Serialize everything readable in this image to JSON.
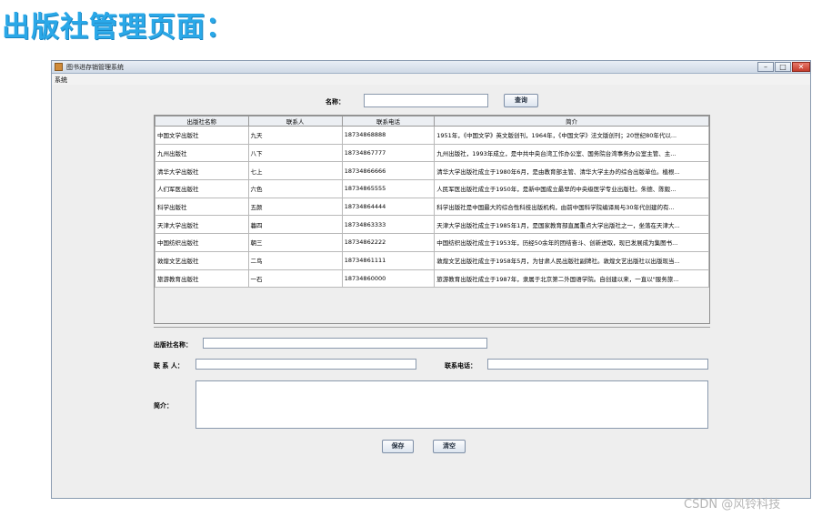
{
  "heading": "出版社管理页面：",
  "window": {
    "title": "图书进存销管理系统",
    "minimize": "–",
    "maximize": "□",
    "close": "✕",
    "menu": [
      "系统"
    ]
  },
  "search": {
    "label": "名称：",
    "value": "",
    "button": "查询"
  },
  "table": {
    "columns": [
      "出版社名称",
      "联系人",
      "联系电话",
      "简介"
    ],
    "rows": [
      [
        "中国文学出版社",
        "九天",
        "18734868888",
        "1951年，《中国文学》英文版创刊，1964年，《中国文学》法文版创刊；20世纪80年代以..."
      ],
      [
        "九州出版社",
        "八下",
        "18734867777",
        "九州出版社，1993年成立，是中共中央台湾工作办公室、国务院台湾事务办公室主管、主..."
      ],
      [
        "清华大学出版社",
        "七上",
        "18734866666",
        "清华大学出版社成立于1980年6月，是由教育部主管、清华大学主办的综合出版单位。植根..."
      ],
      [
        "人们军医出版社",
        "六色",
        "18734865555",
        "人民军医出版社成立于1950年，是新中国成立最早的中央级医学专业出版社。朱德、陈毅..."
      ],
      [
        "科学出版社",
        "五颜",
        "18734864444",
        "科学出版社是中国最大的综合性科技出版机构，由前中国科学院编译局与30年代创建的有..."
      ],
      [
        "天津大学出版社",
        "暮四",
        "18734863333",
        "天津大学出版社成立于1985年1月，是国家教育部直属重点大学出版社之一，坐落在天津大..."
      ],
      [
        "中国纺织出版社",
        "朝三",
        "18734862222",
        "中国纺织出版社成立于1953年，历经50余年的团结奋斗、创新进取，现已发展成为集图书..."
      ],
      [
        "敦煌文艺出版社",
        "二鸟",
        "18734861111",
        "敦煌文艺出版社成立于1958年5月，为甘肃人民出版社副牌社。敦煌文艺出版社以出版现当..."
      ],
      [
        "旅游教育出版社",
        "一石",
        "18734860000",
        "旅游教育出版社成立于1987年，隶属于北京第二外国语学院。自创建以来，一直以\"服务旅..."
      ]
    ]
  },
  "form": {
    "name_label": "出版社名称：",
    "name_value": "",
    "contact_label": "联 系 人：",
    "contact_value": "",
    "phone_label": "联系电话：",
    "phone_value": "",
    "intro_label": "简介：",
    "intro_value": "",
    "save_button": "保存",
    "clear_button": "清空"
  },
  "watermark": "CSDN @风铃科技"
}
